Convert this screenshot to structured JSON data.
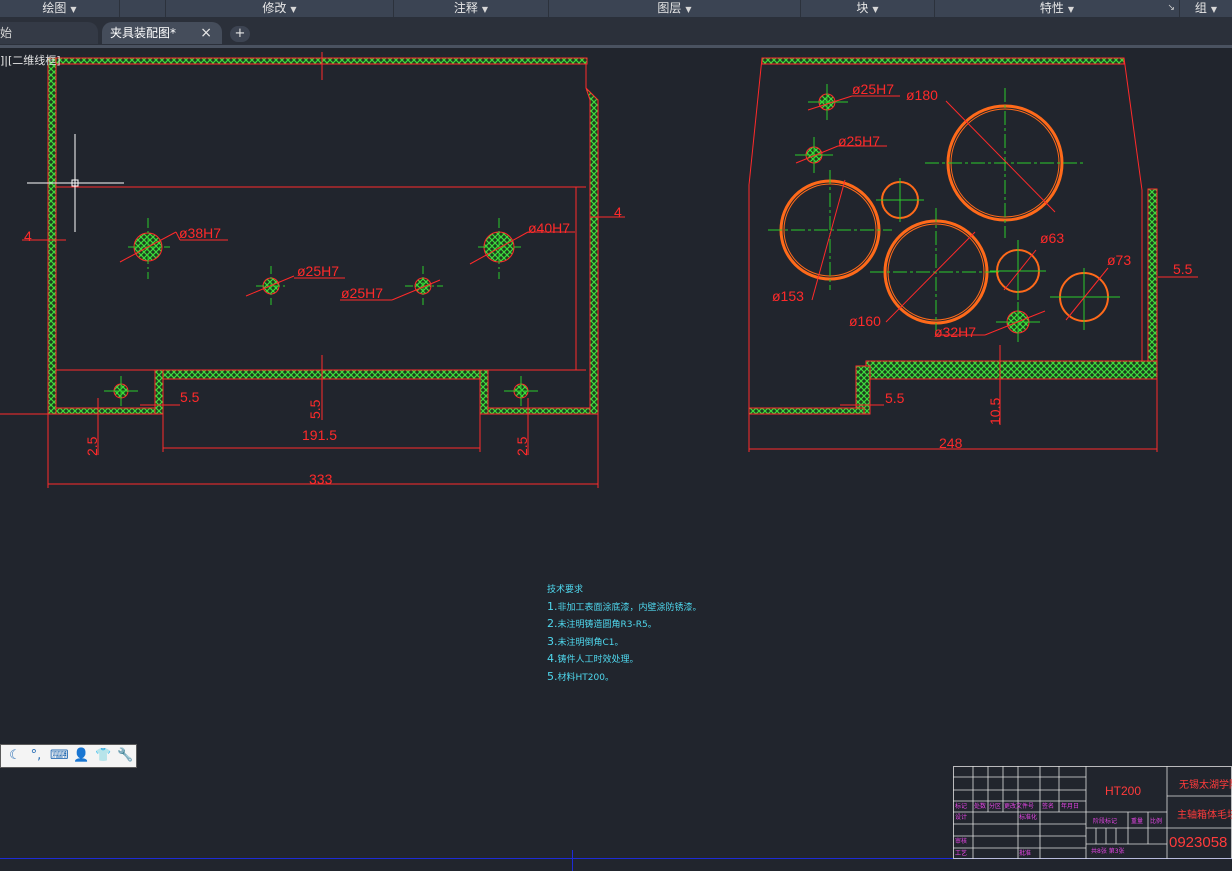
{
  "ribbon": {
    "panels": [
      {
        "label": "绘图"
      },
      {
        "label": "修改"
      },
      {
        "label": "注释"
      },
      {
        "label": "图层"
      },
      {
        "label": "块"
      },
      {
        "label": "特性"
      },
      {
        "label": "组"
      }
    ]
  },
  "tabs": [
    {
      "label": "始",
      "active": false
    },
    {
      "label": "夹具装配图*",
      "active": true
    }
  ],
  "tabbar": {
    "close_icon": "×",
    "new_tab": "+"
  },
  "viewport_label": "]|[二维线框]",
  "drawing": {
    "front_view": {
      "dims": {
        "d38": "ø38H7",
        "d25a": "ø25H7",
        "d25b": "ø25H7",
        "d40": "ø40H7",
        "left4": "4",
        "right4": "4",
        "s55a": "5.5",
        "s55b": "5.5",
        "s25a": "2.5",
        "s25b": "2.5",
        "w1915": "191.5",
        "w333": "333"
      }
    },
    "side_view": {
      "dims": {
        "d25a": "ø25H7",
        "d25b": "ø25H7",
        "d180": "ø180",
        "d153": "ø153",
        "d160": "ø160",
        "d63": "ø63",
        "d73": "ø73",
        "d32": "ø32H7",
        "r55": "5.5",
        "b55": "5.5",
        "h105": "10.5",
        "w248": "248"
      }
    }
  },
  "tech_notes": {
    "title": "技术要求",
    "items": [
      {
        "num": "1.",
        "text": "非加工表面涂底漆，内壁涂防锈漆。"
      },
      {
        "num": "2.",
        "text": "未注明铸造圆角R3-R5。"
      },
      {
        "num": "3.",
        "text": "未注明倒角C1。"
      },
      {
        "num": "4.",
        "text": "铸件人工时效处理。"
      },
      {
        "num": "5.",
        "text": "材料HT200。"
      }
    ]
  },
  "navbar": {
    "icons": [
      "moon-icon",
      "snap-icon",
      "keyboard-icon",
      "user-icon",
      "shirt-icon",
      "wrench-icon"
    ]
  },
  "title_block": {
    "material": "HT200",
    "school": "无锡太湖学院",
    "part_name": "主轴箱体毛坯",
    "drawing_no": "0923058",
    "labels": {
      "biaoji": "标记",
      "chushu": "处数",
      "fenqu": "分区",
      "gengai": "更改文件号",
      "qianming": "签名",
      "nianyueri": "年月日",
      "sheji": "设计",
      "biaozhunhua": "标准化",
      "shenhe": "审核",
      "gongyi": "工艺",
      "pizhun": "批准",
      "jieduan": "阶段标记",
      "zhongliang": "重量",
      "bili": "比例",
      "zhang": "共8张 第3张"
    }
  },
  "colors": {
    "background": "#21252d",
    "outline": "#ff2a2a",
    "hatch": "#3ddb3d",
    "centerline": "#2ccc2c",
    "gear": "#ff6a1a",
    "notes": "#4fd8ee",
    "title_magenta": "#e645e6",
    "frame_blue": "#1d2bd6"
  }
}
